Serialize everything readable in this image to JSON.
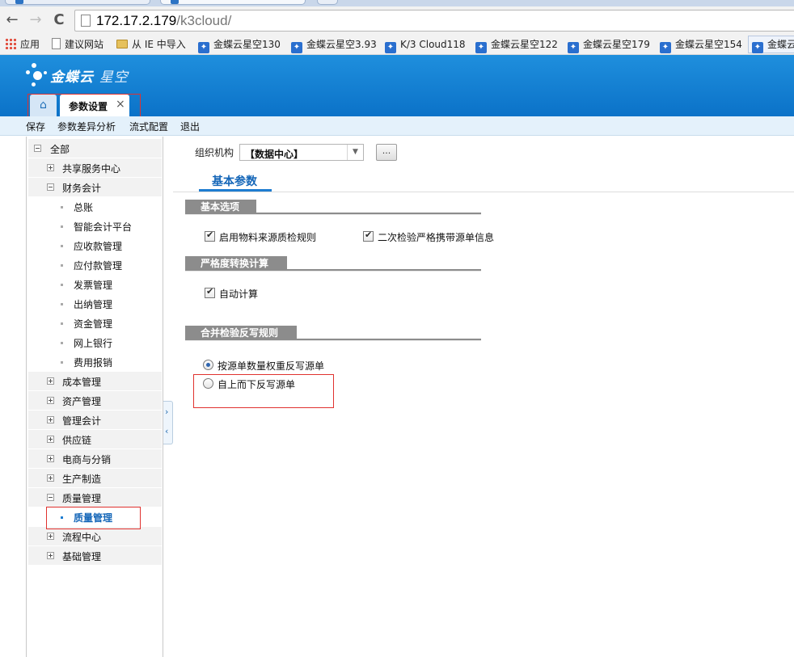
{
  "browser": {
    "url_host": "172.17.2.179",
    "url_path": "/k3cloud/",
    "bookmarks": [
      "应用",
      "建议网站",
      "从 IE 中导入",
      "金蝶云星空130",
      "金蝶云星空3.93",
      "K/3 Cloud118",
      "金蝶云星空122",
      "金蝶云星空179",
      "金蝶云星空154",
      "金蝶云"
    ]
  },
  "header": {
    "logo_bold": "金蝶云",
    "logo_light": "星空",
    "home_icon": "⌂",
    "tab_label": "参数设置",
    "tab_close": "×"
  },
  "actions": [
    "保存",
    "参数差异分析",
    "流式配置",
    "退出"
  ],
  "tree": {
    "root": "全部",
    "nodes": [
      "共享服务中心",
      "财务会计",
      "总账",
      "智能会计平台",
      "应收款管理",
      "应付款管理",
      "发票管理",
      "出纳管理",
      "资金管理",
      "网上银行",
      "费用报销",
      "成本管理",
      "资产管理",
      "管理会计",
      "供应链",
      "电商与分销",
      "生产制造",
      "质量管理",
      "质量管理",
      "流程中心",
      "基础管理"
    ]
  },
  "main": {
    "org_label": "组织机构",
    "org_value": "【数据中心】",
    "org_more": "...",
    "tab_label": "基本参数",
    "sections": {
      "basic": "基本选项",
      "strict": "严格度转换计算",
      "merge": "合并检验反写规则"
    },
    "options": {
      "enable_material_rule": "启用物料来源质检规则",
      "secondary_check": "二次检验严格携带源单信息",
      "auto_calc": "自动计算",
      "radio_weight": "按源单数量权重反写源单",
      "radio_topdown": "自上而下反写源单"
    }
  },
  "colors": {
    "header_blue": "#0b72c8",
    "accent": "#1f7dd1",
    "annotation_red": "#e0322f"
  }
}
